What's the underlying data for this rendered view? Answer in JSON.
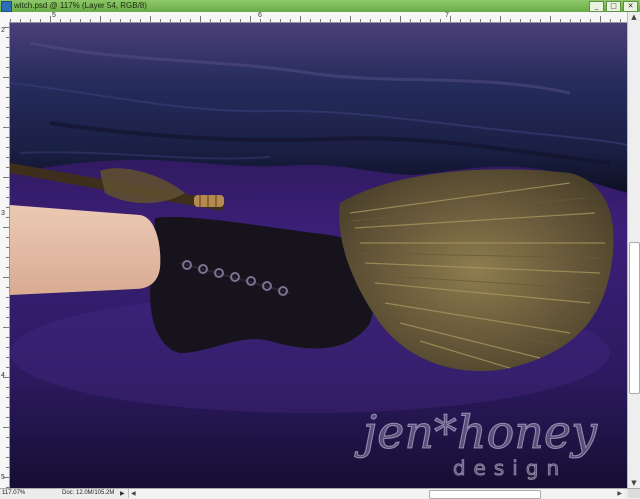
{
  "window": {
    "title": "witch.psd @ 117% (Layer 54, RGB/8)",
    "minimize_glyph": "_",
    "maximize_glyph": "□",
    "close_glyph": "✕"
  },
  "ruler_top": {
    "numbers": [
      "5",
      "6",
      "7"
    ]
  },
  "ruler_left": {
    "numbers": [
      "2",
      "3",
      "4",
      "5"
    ]
  },
  "canvas": {
    "watermark_main": "jen*honey",
    "watermark_sub": "design"
  },
  "status": {
    "zoom": "117.07%",
    "doc_info": "Doc: 12.0M/105.2M",
    "info_arrow": "▶"
  },
  "colors": {
    "titlebar": "#6aab45",
    "sky": "#3a1f6e",
    "cloak": "#222a54",
    "broom_straw": "#8a7a4a"
  }
}
